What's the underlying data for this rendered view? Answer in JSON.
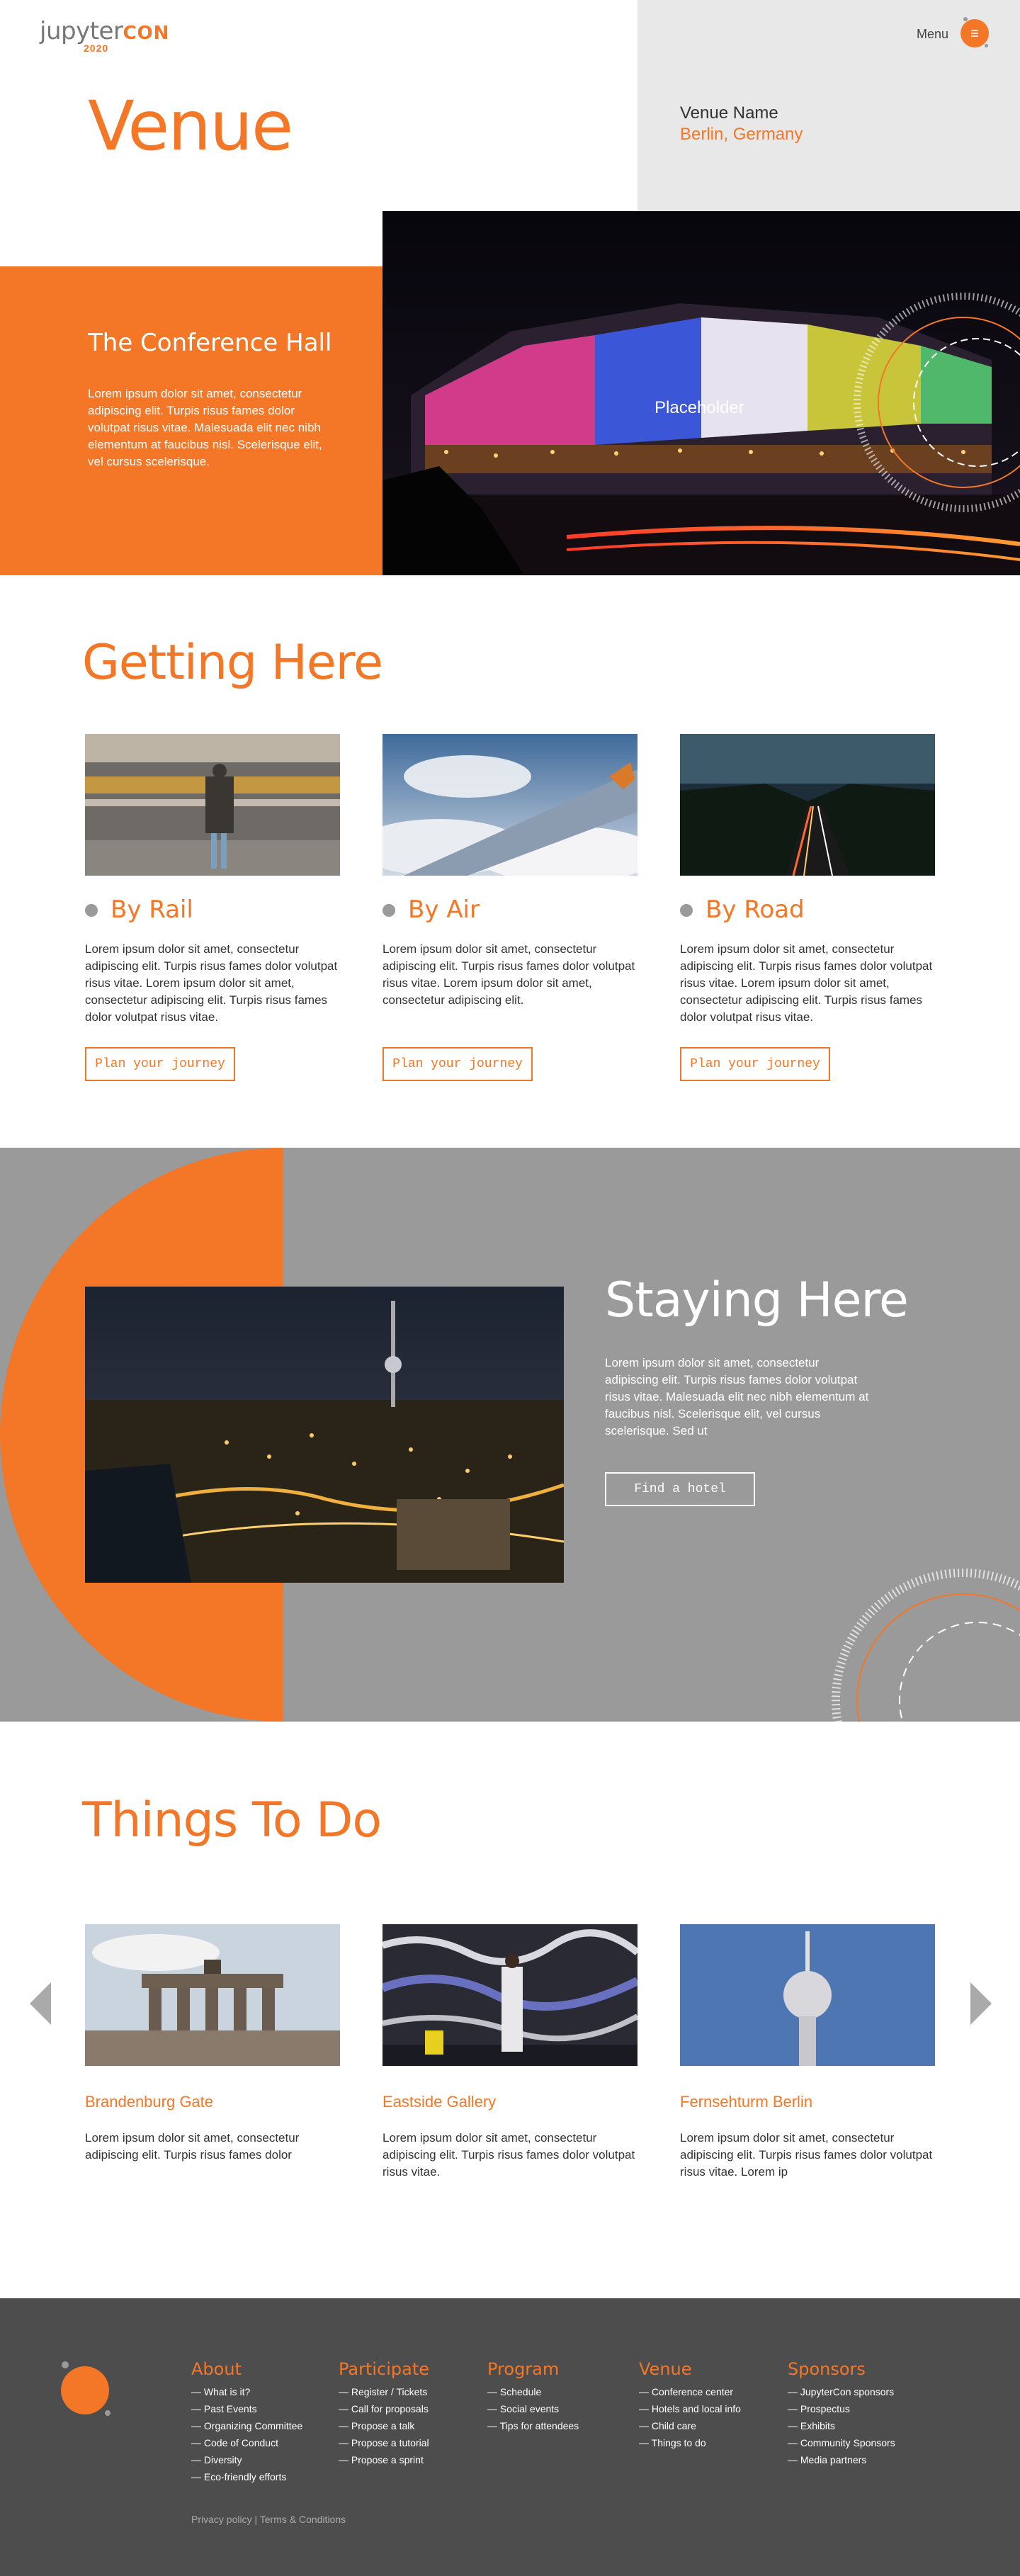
{
  "brand": {
    "logo_word": "jupyter",
    "logo_con": "CON",
    "logo_year": "2020"
  },
  "header": {
    "menu_label": "Menu",
    "menu_icon": "hamburger-icon"
  },
  "hero": {
    "title": "Venue",
    "venue_name": "Venue Name",
    "venue_city": "Berlin, Germany"
  },
  "hall": {
    "title": "The Conference Hall",
    "text": "Lorem ipsum dolor sit amet, consectetur adipiscing elit. Turpis risus fames dolor volutpat risus vitae. Malesuada elit nec nibh elementum at faucibus nisl. Scelerisque elit, vel cursus scelerisque.",
    "image_caption": "Placeholder"
  },
  "getting_here": {
    "title": "Getting Here",
    "cards": [
      {
        "heading": "By Rail",
        "text": "Lorem ipsum dolor sit amet, consectetur adipiscing elit. Turpis risus fames dolor volutpat risus vitae. Lorem ipsum dolor sit amet, consectetur adipiscing elit. Turpis risus fames dolor volutpat risus vitae.",
        "button": "Plan your journey"
      },
      {
        "heading": "By Air",
        "text": "Lorem ipsum dolor sit amet, consectetur adipiscing elit. Turpis risus fames dolor volutpat risus vitae. Lorem ipsum dolor sit amet, consectetur adipiscing elit.",
        "button": "Plan your journey"
      },
      {
        "heading": "By Road",
        "text": "Lorem ipsum dolor sit amet, consectetur adipiscing elit. Turpis risus fames dolor volutpat risus vitae. Lorem ipsum dolor sit amet, consectetur adipiscing elit. Turpis risus fames dolor volutpat risus vitae.",
        "button": "Plan your journey"
      }
    ]
  },
  "staying_here": {
    "title": "Staying Here",
    "text": "Lorem ipsum dolor sit amet, consectetur adipiscing elit. Turpis risus fames dolor volutpat risus vitae. Malesuada elit nec nibh elementum at faucibus nisl. Scelerisque elit, vel cursus scelerisque. Sed ut",
    "button": "Find a hotel"
  },
  "things_to_do": {
    "title": "Things To Do",
    "items": [
      {
        "title": "Brandenburg Gate",
        "text": "Lorem ipsum dolor sit amet, consectetur adipiscing elit. Turpis risus fames dolor"
      },
      {
        "title": "Eastside Gallery",
        "text": "Lorem ipsum dolor sit amet, consectetur adipiscing elit. Turpis risus fames dolor volutpat risus vitae."
      },
      {
        "title": "Fernsehturm Berlin",
        "text": "Lorem ipsum dolor sit amet, consectetur adipiscing elit. Turpis risus fames dolor volutpat risus vitae. Lorem ip"
      }
    ]
  },
  "footer": {
    "columns": [
      {
        "head": "About",
        "items": [
          "— What is it?",
          "— Past Events",
          "— Organizing Committee",
          "— Code of Conduct",
          "— Diversity",
          "— Eco-friendly efforts"
        ]
      },
      {
        "head": "Participate",
        "items": [
          "— Register / Tickets",
          "— Call for proposals",
          "— Propose a talk",
          "— Propose a tutorial",
          "— Propose a sprint"
        ]
      },
      {
        "head": "Program",
        "items": [
          "— Schedule",
          "— Social events",
          "— Tips for attendees"
        ]
      },
      {
        "head": "Venue",
        "items": [
          "— Conference center",
          "— Hotels and local info",
          "— Child care",
          "— Things to do"
        ]
      },
      {
        "head": "Sponsors",
        "items": [
          "— JupyterCon sponsors",
          "— Prospectus",
          "— Exhibits",
          "— Community Sponsors",
          "— Media partners"
        ]
      }
    ],
    "legal": "Privacy policy | Terms & Conditions"
  },
  "colors": {
    "accent": "#F37726",
    "grey_panel": "#9a9a9a",
    "footer": "#4d4d4d"
  }
}
